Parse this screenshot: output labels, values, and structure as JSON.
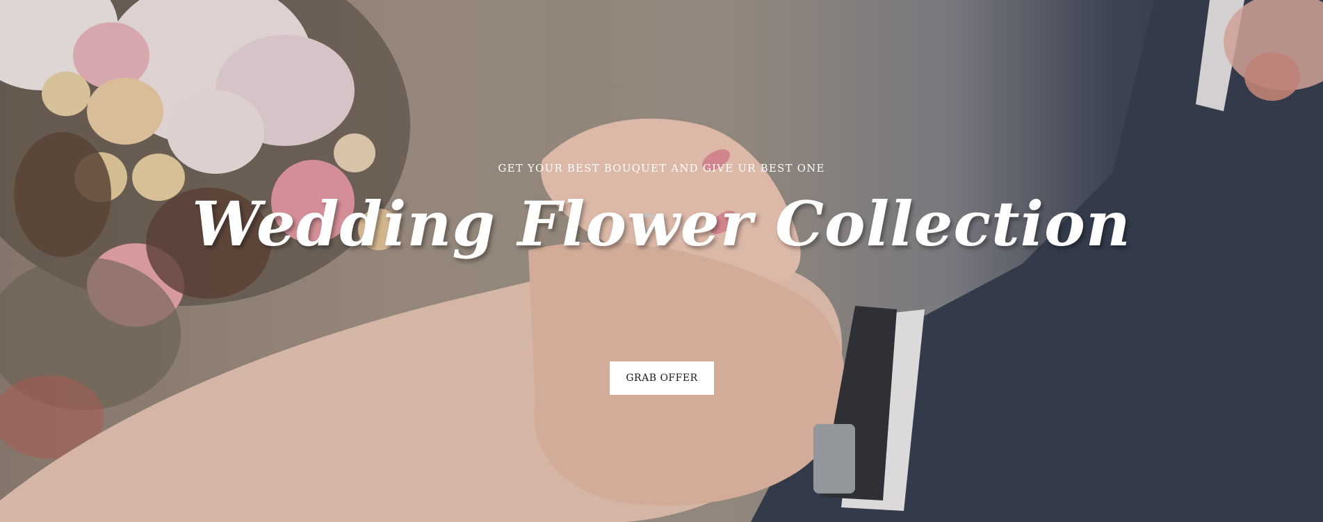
{
  "hero": {
    "subtitle": "GET YOUR BEST BOUQUET AND GIVE UR BEST ONE",
    "title": "Wedding Flower Collection",
    "cta_label": "GRAB OFFER"
  },
  "colors": {
    "background_warm": "#9f9183",
    "suit_navy": "#2f3949",
    "skin": "#e8c2ad",
    "rose_pink": "#e9a7ad",
    "button_bg": "#ffffff",
    "button_text": "#1a1a1a"
  },
  "image": {
    "description_icon": "wedding-ring-photo"
  }
}
